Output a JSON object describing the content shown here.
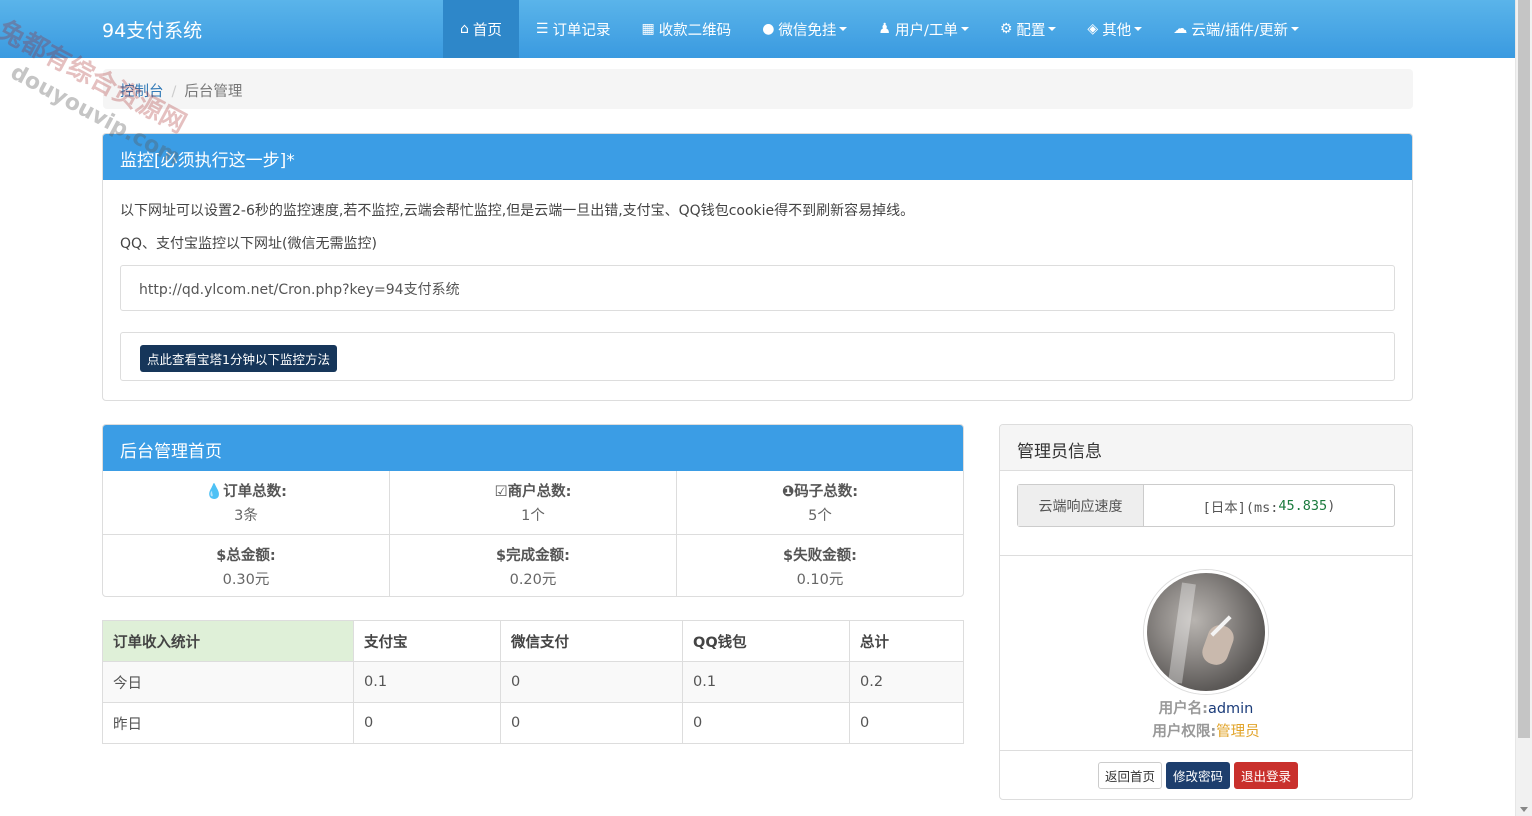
{
  "navbar": {
    "brand": "94支付系统",
    "items": [
      {
        "label": "首页",
        "icon": "home-icon",
        "active": true
      },
      {
        "label": "订单记录",
        "icon": "list-icon"
      },
      {
        "label": "收款二维码",
        "icon": "qrcode-icon"
      },
      {
        "label": "微信免挂",
        "icon": "wechat-icon",
        "dropdown": true
      },
      {
        "label": "用户/工单",
        "icon": "user-icon",
        "dropdown": true
      },
      {
        "label": "配置",
        "icon": "gear-icon",
        "dropdown": true
      },
      {
        "label": "其他",
        "icon": "cube-icon",
        "dropdown": true
      },
      {
        "label": "云端/插件/更新",
        "icon": "cloud-icon",
        "dropdown": true
      }
    ]
  },
  "breadcrumb": {
    "root": "控制台",
    "current": "后台管理"
  },
  "monitor": {
    "title": "监控[必须执行这一步]*",
    "description": "以下网址可以设置2-6秒的监控速度,若不监控,云端会帮忙监控,但是云端一旦出错,支付宝、QQ钱包cookie得不到刷新容易掉线。",
    "subtext": "QQ、支付宝监控以下网址(微信无需监控)",
    "url": "http://qd.ylcom.net/Cron.php?key=94支付系统",
    "button_label": "点此查看宝塔1分钟以下监控方法"
  },
  "admin_home": {
    "title": "后台管理首页",
    "stats": [
      {
        "icon": "drop-icon",
        "label": "订单总数:",
        "value": "3条"
      },
      {
        "icon": "checkbox-icon",
        "label": "商户总数:",
        "value": "1个"
      },
      {
        "icon": "info-circle-icon",
        "label": "码子总数:",
        "value": "5个"
      },
      {
        "icon": "dollar-icon",
        "label": "总金额:",
        "value": "0.30元"
      },
      {
        "icon": "dollar-icon",
        "label": "完成金额:",
        "value": "0.20元"
      },
      {
        "icon": "dollar-icon",
        "label": "失败金额:",
        "value": "0.10元"
      }
    ]
  },
  "income_table": {
    "headers": [
      "订单收入统计",
      "支付宝",
      "微信支付",
      "QQ钱包",
      "总计"
    ],
    "rows": [
      [
        "今日",
        "0.1",
        "0",
        "0.1",
        "0.2"
      ],
      [
        "昨日",
        "0",
        "0",
        "0",
        "0"
      ]
    ]
  },
  "admin_info": {
    "title": "管理员信息",
    "speed_label": "云端响应速度",
    "speed_prefix": "[日本](ms:",
    "speed_value": "45.835",
    "speed_suffix": ")",
    "username_label": "用户名:",
    "username": "admin",
    "role_label": "用户权限:",
    "role": "管理员",
    "buttons": {
      "home": "返回首页",
      "password": "修改密码",
      "logout": "退出登录"
    }
  },
  "watermark": {
    "line1": "兔都有综合资源网",
    "line2": "douyouvip.com"
  },
  "colors": {
    "nav": "#3a9ae0",
    "panel_head": "#3b9de5",
    "dark_button": "#16365a",
    "danger": "#c9302c",
    "role": "#e2a42a"
  }
}
